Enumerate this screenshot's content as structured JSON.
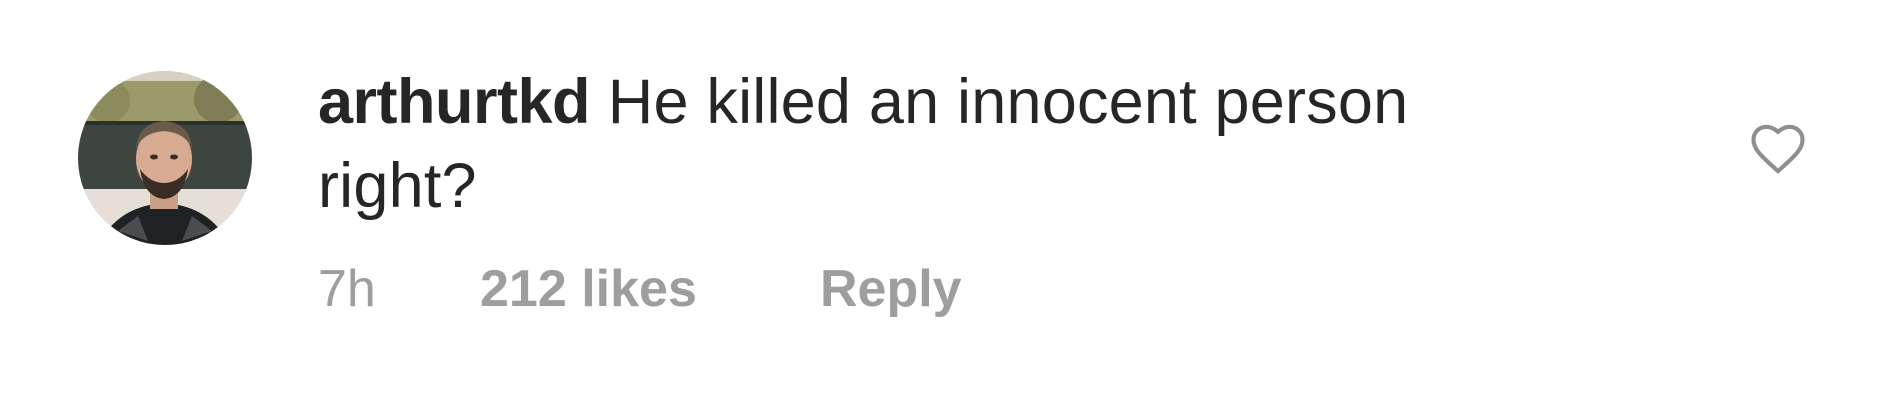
{
  "comment": {
    "username": "arthurtkd",
    "text": "He killed an innocent person right?",
    "time": "7h",
    "likes": "212 likes",
    "reply_label": "Reply",
    "avatar_icon": "user-avatar-photo",
    "like_icon": "heart-outline-icon"
  },
  "colors": {
    "text_primary": "#262626",
    "text_secondary": "#9e9e9e",
    "background": "#ffffff"
  }
}
